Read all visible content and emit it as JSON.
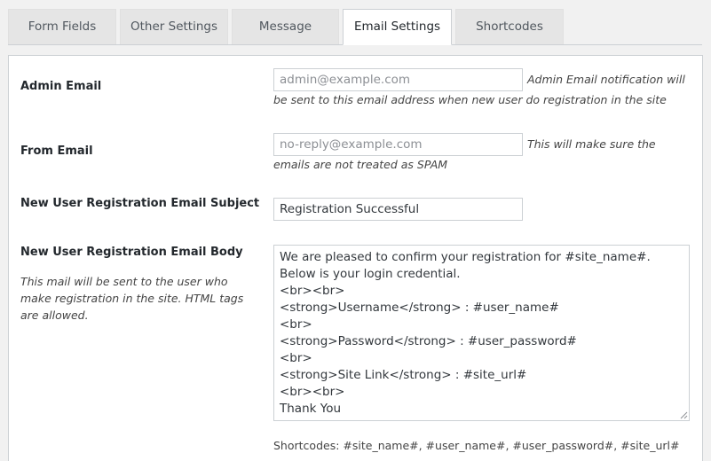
{
  "tabs": [
    {
      "label": "Form Fields"
    },
    {
      "label": "Other Settings"
    },
    {
      "label": "Message"
    },
    {
      "label": "Email Settings"
    },
    {
      "label": "Shortcodes"
    }
  ],
  "fields": {
    "admin_email": {
      "label": "Admin Email",
      "placeholder": "admin@example.com",
      "description": "Admin Email notification will be sent to this email address when new user do registration in the site"
    },
    "from_email": {
      "label": "From Email",
      "placeholder": "no-reply@example.com",
      "description": "This will make sure the emails are not treated as SPAM"
    },
    "subject": {
      "label": "New User Registration Email Subject",
      "value": "Registration Successful"
    },
    "body": {
      "label": "New User Registration Email Body",
      "note": "This mail will be sent to the user who make registration in the site. HTML tags are allowed.",
      "value": "We are pleased to confirm your registration for #site_name#. Below is your login credential.\n<br><br>\n<strong>Username</strong> : #user_name#\n<br>\n<strong>Password</strong> : #user_password#\n<br>\n<strong>Site Link</strong> : #site_url#\n<br><br>\nThank You"
    }
  },
  "shortcodes_text": "Shortcodes: #site_name#, #user_name#, #user_password#, #site_url#"
}
